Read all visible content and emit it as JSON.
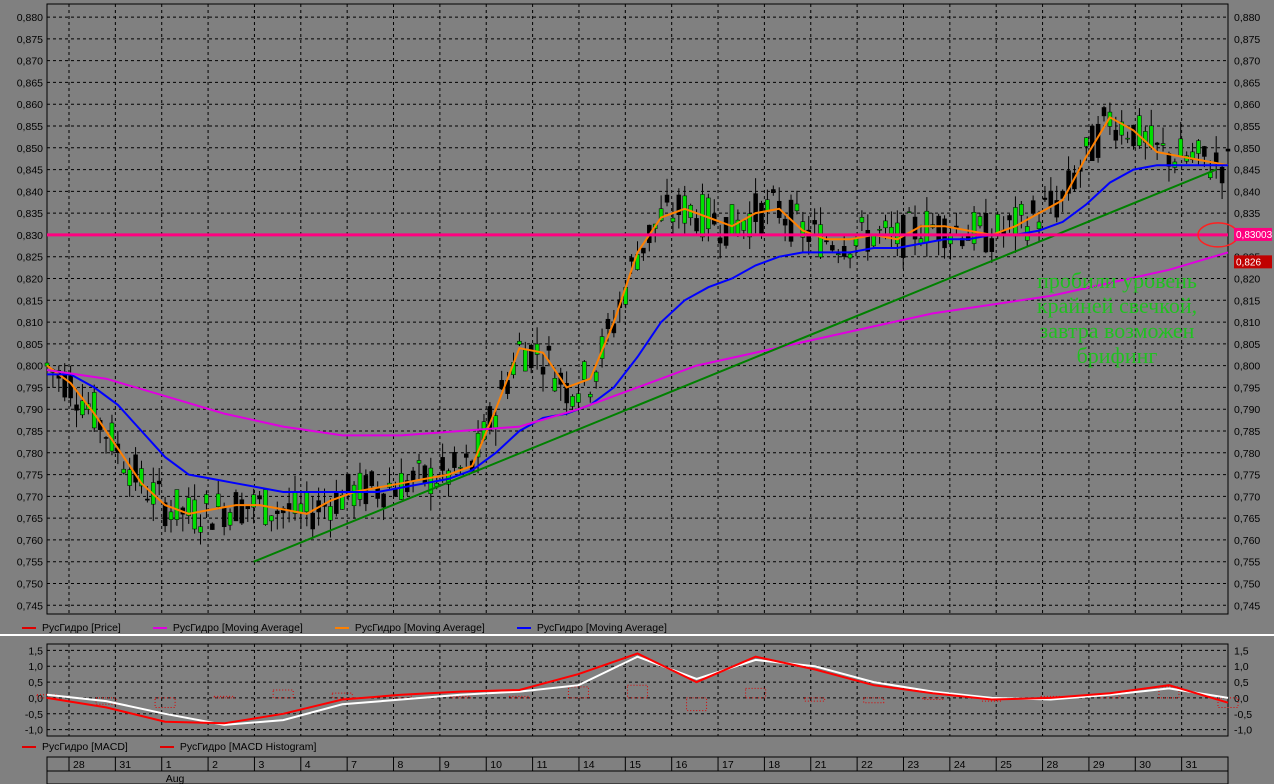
{
  "chart_data": [
    {
      "type": "candlestick",
      "instrument": "РусГидро",
      "yticks": [
        "0,880",
        "0,875",
        "0,870",
        "0,865",
        "0,860",
        "0,855",
        "0,850",
        "0,845",
        "0,840",
        "0,835",
        "0,830",
        "0,825",
        "0,820",
        "0,815",
        "0,810",
        "0,805",
        "0,800",
        "0,795",
        "0,790",
        "0,785",
        "0,780",
        "0,775",
        "0,770",
        "0,765",
        "0,760",
        "0,755",
        "0,750",
        "0,745"
      ],
      "ylim": [
        0.743,
        0.883
      ],
      "grid": true,
      "legend": "bottom",
      "legend_entries": [
        {
          "label": "РусГидро [Price]",
          "color": "#e00000"
        },
        {
          "label": "РусГидро [Moving Average]",
          "color": "#e000e0"
        },
        {
          "label": "РусГидро [Moving Average]",
          "color": "#ff8000"
        },
        {
          "label": "РусГидро [Moving Average]",
          "color": "#0000ff"
        }
      ],
      "series": [
        {
          "color": "#ff8000",
          "x": [
            0,
            4,
            8,
            12,
            16,
            20,
            24,
            28,
            32,
            36,
            40,
            44,
            48,
            52,
            56,
            60,
            64,
            68,
            72,
            76,
            80,
            84,
            88,
            92,
            96,
            100,
            104,
            108,
            112,
            116,
            120,
            124,
            128,
            132,
            136,
            140,
            144,
            148,
            152,
            156,
            160,
            164,
            168,
            172,
            176,
            180,
            184,
            188,
            192,
            196,
            200
          ],
          "values": [
            0.8,
            0.796,
            0.789,
            0.781,
            0.773,
            0.768,
            0.766,
            0.767,
            0.768,
            0.768,
            0.767,
            0.766,
            0.769,
            0.771,
            0.772,
            0.773,
            0.774,
            0.775,
            0.777,
            0.79,
            0.804,
            0.803,
            0.795,
            0.797,
            0.81,
            0.826,
            0.834,
            0.836,
            0.834,
            0.832,
            0.835,
            0.836,
            0.831,
            0.829,
            0.829,
            0.83,
            0.829,
            0.832,
            0.832,
            0.831,
            0.83,
            0.832,
            0.835,
            0.838,
            0.848,
            0.857,
            0.854,
            0.849,
            0.848,
            0.847,
            0.846
          ]
        },
        {
          "color": "#0000ff",
          "x": [
            0,
            4,
            8,
            12,
            16,
            20,
            24,
            28,
            32,
            36,
            40,
            44,
            48,
            52,
            56,
            60,
            64,
            68,
            72,
            76,
            80,
            84,
            88,
            92,
            96,
            100,
            104,
            108,
            112,
            116,
            120,
            124,
            128,
            132,
            136,
            140,
            144,
            148,
            152,
            156,
            160,
            164,
            168,
            172,
            176,
            180,
            184,
            188,
            192,
            196,
            200
          ],
          "values": [
            0.798,
            0.798,
            0.795,
            0.791,
            0.785,
            0.779,
            0.775,
            0.774,
            0.773,
            0.772,
            0.771,
            0.771,
            0.771,
            0.771,
            0.771,
            0.772,
            0.773,
            0.774,
            0.776,
            0.78,
            0.785,
            0.788,
            0.789,
            0.791,
            0.795,
            0.802,
            0.81,
            0.815,
            0.818,
            0.82,
            0.823,
            0.825,
            0.826,
            0.826,
            0.826,
            0.827,
            0.827,
            0.828,
            0.829,
            0.829,
            0.83,
            0.83,
            0.831,
            0.833,
            0.837,
            0.842,
            0.845,
            0.846,
            0.846,
            0.846,
            0.846
          ]
        },
        {
          "color": "#e000e0",
          "x": [
            0,
            10,
            20,
            30,
            40,
            50,
            60,
            70,
            80,
            90,
            100,
            110,
            120,
            130,
            140,
            150,
            160,
            170,
            180,
            190,
            200
          ],
          "values": [
            0.799,
            0.797,
            0.793,
            0.789,
            0.786,
            0.784,
            0.784,
            0.785,
            0.786,
            0.79,
            0.795,
            0.8,
            0.803,
            0.806,
            0.809,
            0.812,
            0.814,
            0.816,
            0.819,
            0.822,
            0.826
          ]
        },
        {
          "color": "#008000",
          "x": [
            35,
            198
          ],
          "values": [
            0.755,
            0.845
          ]
        },
        {
          "color": "#ff0080",
          "x": [
            0,
            200
          ],
          "values": [
            0.83,
            0.83
          ]
        }
      ],
      "price_tags": [
        {
          "text": "0,83003",
          "value": 0.83,
          "background": "#ff0080"
        },
        {
          "text": "0,826",
          "value": 0.826,
          "background": "#c00000"
        }
      ],
      "annotation": [
        "пробили уровень",
        "крайней свечкой,",
        "завтра возможен",
        "брифинг"
      ]
    },
    {
      "type": "line",
      "title": "MACD",
      "yticks": [
        "1,5",
        "1,0",
        "0,5",
        "0,0",
        "-0,5",
        "-1,0"
      ],
      "ylim": [
        -1.2,
        1.7
      ],
      "legend": "bottom",
      "legend_entries": [
        {
          "label": "РусГидро [MACD]",
          "color": "#e00000"
        },
        {
          "label": "РусГидро [MACD Histogram]",
          "color": "#e00000"
        }
      ],
      "series": [
        {
          "color": "#ffffff",
          "x": [
            0,
            10,
            20,
            30,
            40,
            50,
            60,
            70,
            80,
            90,
            100,
            110,
            120,
            130,
            140,
            150,
            160,
            170,
            180,
            190,
            200
          ],
          "values": [
            0.1,
            -0.1,
            -0.5,
            -0.85,
            -0.7,
            -0.2,
            -0.05,
            0.1,
            0.2,
            0.4,
            1.3,
            0.6,
            1.2,
            1.0,
            0.5,
            0.2,
            0.0,
            -0.05,
            0.1,
            0.3,
            0.0
          ]
        },
        {
          "color": "#ff0000",
          "x": [
            0,
            10,
            20,
            30,
            40,
            50,
            60,
            70,
            80,
            90,
            100,
            110,
            120,
            130,
            140,
            150,
            160,
            170,
            180,
            190,
            200
          ],
          "values": [
            0.0,
            -0.3,
            -0.75,
            -0.8,
            -0.5,
            -0.05,
            0.1,
            0.2,
            0.25,
            0.75,
            1.4,
            0.5,
            1.3,
            0.9,
            0.4,
            0.15,
            -0.05,
            0.0,
            0.15,
            0.4,
            -0.15
          ]
        }
      ],
      "histogram": [
        0.1,
        -0.2,
        -0.3,
        0.05,
        0.25,
        0.15,
        0.1,
        0.05,
        0.05,
        0.35,
        0.4,
        -0.4,
        0.3,
        -0.1,
        -0.15,
        -0.05,
        -0.1,
        0.05,
        0.1,
        0.35,
        -0.3
      ]
    }
  ],
  "time_axis": {
    "days": [
      "28",
      "31",
      "1",
      "2",
      "3",
      "4",
      "7",
      "8",
      "9",
      "10",
      "11",
      "14",
      "15",
      "16",
      "17",
      "18",
      "21",
      "22",
      "23",
      "24",
      "25",
      "28",
      "29",
      "30",
      "31"
    ],
    "month": "Aug"
  }
}
